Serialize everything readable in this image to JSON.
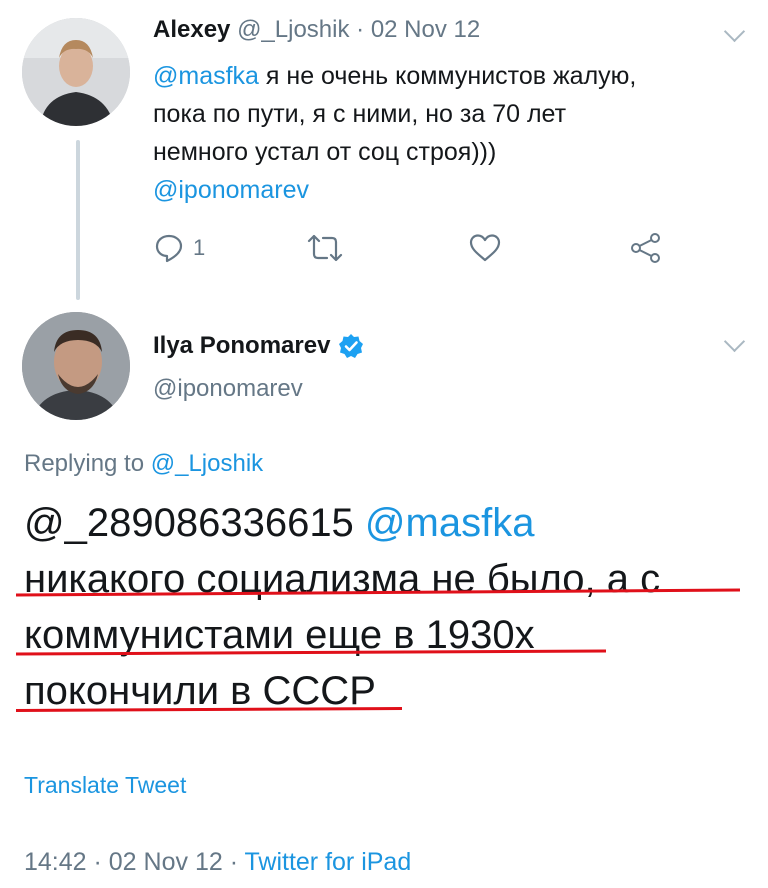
{
  "tweet1": {
    "author_name": "Alexey",
    "author_handle": "@_Ljoshik",
    "separator": " · ",
    "date": "02 Nov 12",
    "mention": "@masfka",
    "text_line1_rest": " я не очень коммунистов жалую,",
    "text_line2": "пока по пути, я с ними, но за 70 лет",
    "text_line3": "немного устал от соц строя)))",
    "text_line4_mention": "@iponomarev",
    "reply_count": "1",
    "icons": [
      "reply-icon",
      "retweet-icon",
      "like-icon",
      "share-icon",
      "chevron-down-icon"
    ]
  },
  "tweet2": {
    "author_name": "Ilya Ponomarev",
    "author_handle": "@iponomarev",
    "replying_prefix": "Replying to ",
    "replying_handle": "@_Ljoshik",
    "body_line1_plain": "@_289086336615 ",
    "body_line1_link": "@masfka",
    "body_line2": "никакого социализма не было, а с",
    "body_line3": "коммунистами еще в 1930х",
    "body_line4": "покончили в СССР",
    "translate": "Translate Tweet",
    "time": "14:42",
    "date_sep": " · ",
    "date": "02 Nov 12",
    "source_sep": " · ",
    "source": "Twitter for iPad",
    "icons": [
      "verified-badge-icon",
      "chevron-down-icon"
    ]
  },
  "colors": {
    "link": "#1b95e0",
    "muted": "#657786",
    "text": "#14171a",
    "underline": "#e0101a",
    "thread_line": "#ccd6dd"
  }
}
